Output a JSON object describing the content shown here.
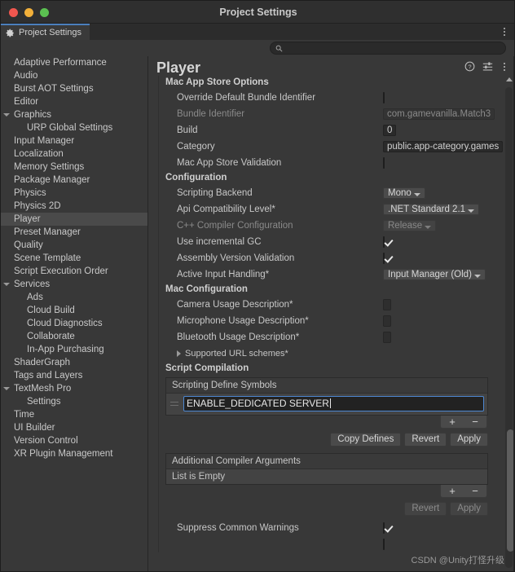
{
  "window": {
    "title": "Project Settings"
  },
  "tab": {
    "label": "Project Settings",
    "icon": "gear-icon",
    "menu_icon": "kebab-menu-icon"
  },
  "search": {
    "value": "",
    "placeholder": "",
    "icon": "search-icon"
  },
  "sidebar": {
    "items": [
      {
        "label": "Adaptive Performance",
        "indent": 0,
        "arrow": "none",
        "selected": false
      },
      {
        "label": "Audio",
        "indent": 0,
        "arrow": "none",
        "selected": false
      },
      {
        "label": "Burst AOT Settings",
        "indent": 0,
        "arrow": "none",
        "selected": false
      },
      {
        "label": "Editor",
        "indent": 0,
        "arrow": "none",
        "selected": false
      },
      {
        "label": "Graphics",
        "indent": 0,
        "arrow": "open",
        "selected": false
      },
      {
        "label": "URP Global Settings",
        "indent": 1,
        "arrow": "none",
        "selected": false
      },
      {
        "label": "Input Manager",
        "indent": 0,
        "arrow": "none",
        "selected": false
      },
      {
        "label": "Localization",
        "indent": 0,
        "arrow": "none",
        "selected": false
      },
      {
        "label": "Memory Settings",
        "indent": 0,
        "arrow": "none",
        "selected": false
      },
      {
        "label": "Package Manager",
        "indent": 0,
        "arrow": "none",
        "selected": false
      },
      {
        "label": "Physics",
        "indent": 0,
        "arrow": "none",
        "selected": false
      },
      {
        "label": "Physics 2D",
        "indent": 0,
        "arrow": "none",
        "selected": false
      },
      {
        "label": "Player",
        "indent": 0,
        "arrow": "none",
        "selected": true
      },
      {
        "label": "Preset Manager",
        "indent": 0,
        "arrow": "none",
        "selected": false
      },
      {
        "label": "Quality",
        "indent": 0,
        "arrow": "none",
        "selected": false
      },
      {
        "label": "Scene Template",
        "indent": 0,
        "arrow": "none",
        "selected": false
      },
      {
        "label": "Script Execution Order",
        "indent": 0,
        "arrow": "none",
        "selected": false
      },
      {
        "label": "Services",
        "indent": 0,
        "arrow": "open",
        "selected": false
      },
      {
        "label": "Ads",
        "indent": 1,
        "arrow": "none",
        "selected": false
      },
      {
        "label": "Cloud Build",
        "indent": 1,
        "arrow": "none",
        "selected": false
      },
      {
        "label": "Cloud Diagnostics",
        "indent": 1,
        "arrow": "none",
        "selected": false
      },
      {
        "label": "Collaborate",
        "indent": 1,
        "arrow": "none",
        "selected": false
      },
      {
        "label": "In-App Purchasing",
        "indent": 1,
        "arrow": "none",
        "selected": false
      },
      {
        "label": "ShaderGraph",
        "indent": 0,
        "arrow": "none",
        "selected": false
      },
      {
        "label": "Tags and Layers",
        "indent": 0,
        "arrow": "none",
        "selected": false
      },
      {
        "label": "TextMesh Pro",
        "indent": 0,
        "arrow": "open",
        "selected": false
      },
      {
        "label": "Settings",
        "indent": 1,
        "arrow": "none",
        "selected": false
      },
      {
        "label": "Time",
        "indent": 0,
        "arrow": "none",
        "selected": false
      },
      {
        "label": "UI Builder",
        "indent": 0,
        "arrow": "none",
        "selected": false
      },
      {
        "label": "Version Control",
        "indent": 0,
        "arrow": "none",
        "selected": false
      },
      {
        "label": "XR Plugin Management",
        "indent": 0,
        "arrow": "none",
        "selected": false
      }
    ]
  },
  "panel": {
    "title": "Player",
    "help_icon": "help-icon",
    "preset_icon": "preset-sliders-icon",
    "menu_icon": "kebab-menu-icon"
  },
  "sections": {
    "mac_app_store": {
      "heading": "Mac App Store Options",
      "rows": [
        {
          "label": "Override Default Bundle Identifier",
          "type": "checkbox",
          "checked": false,
          "disabled": false
        },
        {
          "label": "Bundle Identifier",
          "type": "text",
          "value": "com.gamevanilla.Match3",
          "disabled": true
        },
        {
          "label": "Build",
          "type": "text",
          "value": "0",
          "disabled": false
        },
        {
          "label": "Category",
          "type": "text",
          "value": "public.app-category.games",
          "disabled": false
        },
        {
          "label": "Mac App Store Validation",
          "type": "checkbox",
          "checked": false,
          "disabled": false
        }
      ]
    },
    "configuration": {
      "heading": "Configuration",
      "rows": [
        {
          "label": "Scripting Backend",
          "type": "dropdown",
          "value": "Mono",
          "disabled": false
        },
        {
          "label": "Api Compatibility Level*",
          "type": "dropdown",
          "value": ".NET Standard 2.1",
          "disabled": false
        },
        {
          "label": "C++ Compiler Configuration",
          "type": "dropdown",
          "value": "Release",
          "disabled": true
        },
        {
          "label": "Use incremental GC",
          "type": "checkbox",
          "checked": true,
          "disabled": false
        },
        {
          "label": "Assembly Version Validation",
          "type": "checkbox",
          "checked": true,
          "disabled": false
        },
        {
          "label": "Active Input Handling*",
          "type": "dropdown",
          "value": "Input Manager (Old)",
          "disabled": false
        }
      ]
    },
    "mac_configuration": {
      "heading": "Mac Configuration",
      "rows": [
        {
          "label": "Camera Usage Description*",
          "type": "text",
          "value": "",
          "disabled": false
        },
        {
          "label": "Microphone Usage Description*",
          "type": "text",
          "value": "",
          "disabled": false
        },
        {
          "label": "Bluetooth Usage Description*",
          "type": "text",
          "value": "",
          "disabled": false
        },
        {
          "label": "Supported URL schemes*",
          "type": "foldout",
          "value": "",
          "disabled": false
        }
      ]
    },
    "script_compilation": {
      "heading": "Script Compilation",
      "define_symbols": {
        "list_header": "Scripting Define Symbols",
        "entry_value": "ENABLE_DEDICATED SERVER",
        "add_label": "+",
        "remove_label": "−",
        "copy_defines_label": "Copy Defines",
        "revert_label": "Revert",
        "apply_label": "Apply"
      },
      "additional_args": {
        "list_header": "Additional Compiler Arguments",
        "empty_label": "List is Empty",
        "add_label": "+",
        "remove_label": "−",
        "revert_label": "Revert",
        "apply_label": "Apply"
      },
      "trailing_rows": [
        {
          "label": "Suppress Common Warnings",
          "type": "checkbox",
          "checked": true,
          "disabled": false
        }
      ]
    }
  },
  "watermark": {
    "text": "CSDN @Unity打怪升级"
  }
}
